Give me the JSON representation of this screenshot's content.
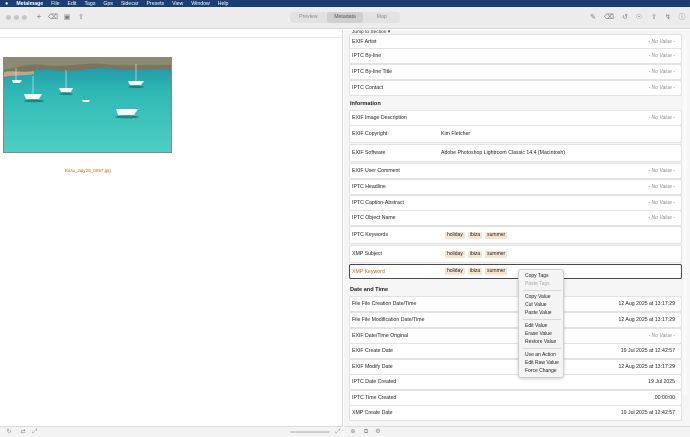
{
  "menubar": {
    "app": "MetaImage",
    "items": [
      "File",
      "Edit",
      "Tags",
      "Gps",
      "Sidecar",
      "Presets",
      "View",
      "Window",
      "Help"
    ]
  },
  "toolbar": {
    "tabs": [
      {
        "label": "Preview"
      },
      {
        "label": "Metadata"
      },
      {
        "label": "Map"
      }
    ],
    "active_tab": "Metadata"
  },
  "left": {
    "filename": "Ibiza_July25_0057.jpg"
  },
  "right": {
    "jump": "Jump to Section ▾",
    "no_value": "- No Value -",
    "rows_top": [
      {
        "label": "EXIF Artist",
        "value": "- No Value -",
        "kind": "nv"
      },
      {
        "label": "IPTC By-line",
        "value": "- No Value -",
        "kind": "nv"
      },
      {
        "label": "IPTC By-line Title",
        "value": "- No Value -",
        "kind": "nv"
      },
      {
        "label": "IPTC Contact",
        "value": "- No Value -",
        "kind": "nv"
      }
    ],
    "section_info": "Information",
    "rows_info": [
      {
        "label": "EXIF Image Description",
        "value": "- No Value -",
        "kind": "nv"
      },
      {
        "label": "EXIF Copyright",
        "value": "Kim Fletcher",
        "kind": "text"
      },
      {
        "label": "EXIF Software",
        "value": "Adobe Photoshop Lightroom Classic 14.4 (Macintosh)",
        "kind": "text"
      },
      {
        "label": "EXIF User Comment",
        "value": "- No Value -",
        "kind": "nv"
      },
      {
        "label": "IPTC Headline",
        "value": "- No Value -",
        "kind": "nv"
      },
      {
        "label": "IPTC Caption-Abstract",
        "value": "- No Value -",
        "kind": "nv"
      },
      {
        "label": "IPTC Object Name",
        "value": "- No Value -",
        "kind": "nv"
      },
      {
        "label": "IPTC Keywords",
        "tags": [
          "holiday",
          "ibiza",
          "summer"
        ],
        "kind": "tags"
      },
      {
        "label": "XMP Subject",
        "tags": [
          "holiday",
          "ibiza",
          "summer"
        ],
        "kind": "tags"
      },
      {
        "label": "XMP Keyword",
        "tags": [
          "holiday",
          "ibiza",
          "summer"
        ],
        "kind": "tags"
      }
    ],
    "section_date": "Date and Time",
    "rows_date": [
      {
        "label": "File File Creation Date/Time",
        "value": "12 Aug 2025 at 13:17:29",
        "kind": "right"
      },
      {
        "label": "File File Modification Date/Time",
        "value": "12 Aug 2025 at 13:17:29",
        "kind": "right"
      },
      {
        "label": "EXIF Date/Time Original",
        "value": "- No Value -",
        "kind": "nv"
      },
      {
        "label": "EXIF Create Date",
        "value": "19 Jul 2025 at 12:42:57",
        "kind": "right"
      },
      {
        "label": "EXIF Modify Date",
        "value": "12 Aug 2025 at 13:17:29",
        "kind": "right"
      },
      {
        "label": "IPTC Date Created",
        "value": "19 Jul 2025",
        "kind": "right"
      },
      {
        "label": "IPTC Time Created",
        "value": "00:00:00",
        "kind": "right"
      },
      {
        "label": "XMP Create Date",
        "value": "19 Jul 2025 at 12:42:57",
        "kind": "right"
      }
    ]
  },
  "context_menu": {
    "copy_tags": "Copy Tags",
    "paste_tags": "Paste Tags",
    "copy_value": "Copy Value",
    "cut_value": "Cut Value",
    "paste_value": "Paste Value",
    "edit_value": "Edit Value",
    "erase_value": "Erase Value",
    "restore_value": "Restore Value",
    "use_action": "Use an Action",
    "edit_raw": "Edit Raw Value",
    "force_change": "Force Change"
  },
  "colors": {
    "menubar": "#1b3f70",
    "accent": "#c06a10",
    "tag_bg": "#f6e4d2",
    "sea": "#2fb8b4"
  },
  "icons": [
    "apple-icon",
    "plus-icon",
    "back-icon",
    "image-icon",
    "export-icon",
    "edit-icon",
    "erase-icon",
    "history-icon",
    "location-icon",
    "share-icon",
    "info-icon",
    "bolt-icon",
    "scroll-icon"
  ]
}
